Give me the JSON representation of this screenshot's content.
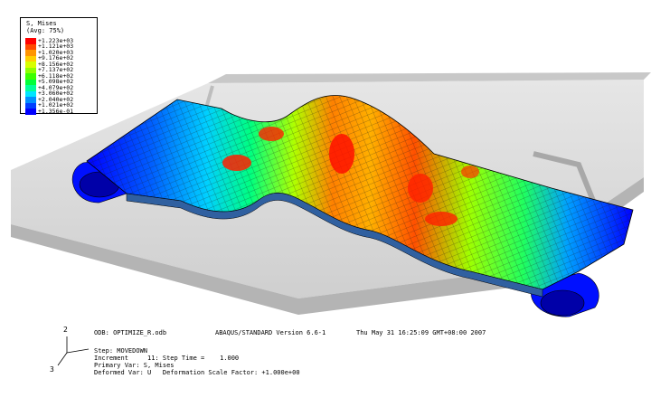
{
  "legend": {
    "title": "S, Mises",
    "subtitle": "(Avg: 75%)",
    "entries": [
      {
        "label": "+1.223e+03",
        "color": "#ff0000"
      },
      {
        "label": "+1.121e+03",
        "color": "#ff4a00"
      },
      {
        "label": "+1.020e+03",
        "color": "#ff9500"
      },
      {
        "label": "+9.176e+02",
        "color": "#ffcf00"
      },
      {
        "label": "+8.156e+02",
        "color": "#d8ff00"
      },
      {
        "label": "+7.137e+02",
        "color": "#8eff00"
      },
      {
        "label": "+6.118e+02",
        "color": "#3cff00"
      },
      {
        "label": "+5.098e+02",
        "color": "#00ff3a"
      },
      {
        "label": "+4.079e+02",
        "color": "#00ff9a"
      },
      {
        "label": "+3.060e+02",
        "color": "#00e5ff"
      },
      {
        "label": "+2.040e+02",
        "color": "#0090ff"
      },
      {
        "label": "+1.021e+02",
        "color": "#0040ff"
      },
      {
        "label": "+1.356e-01",
        "color": "#0000ff"
      }
    ]
  },
  "info": {
    "odb": "ODB: OPTIMIZE_R.odb",
    "solver": "ABAQUS/STANDARD Version 6.6-1",
    "date": "Thu May 31 16:25:09 GMT+08:00 2007",
    "step": "Step: MOVEDOWN",
    "increment": "Increment     11: Step Time =    1.000",
    "primary": "Primary Var: S, Mises",
    "deformed": "Deformed Var: U   Deformation Scale Factor: +1.000e+00"
  },
  "triad": {
    "axis2": "2",
    "axis3": "3"
  },
  "colors": {
    "low": "#0000ff",
    "high": "#ff0000",
    "plate": "#d8d8d8",
    "mesh": "#1a1a1a"
  }
}
